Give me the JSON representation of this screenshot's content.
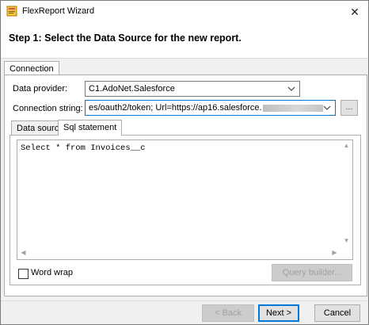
{
  "window": {
    "title": "FlexReport Wizard",
    "close_glyph": "✕"
  },
  "header": {
    "step_title": "Step 1: Select the Data Source for the new report."
  },
  "outer_tabs": [
    {
      "label": "Connection"
    }
  ],
  "connection": {
    "data_provider_label": "Data provider:",
    "data_provider_value": "C1.AdoNet.Salesforce",
    "connection_string_label": "Connection string:",
    "connection_string_value": "es/oauth2/token; Url=https://ap16.salesforce.",
    "browse_label": "..."
  },
  "inner_tabs": [
    {
      "label": "Data source"
    },
    {
      "label": "Sql statement"
    }
  ],
  "sql": {
    "text": "Select * from Invoices__c"
  },
  "word_wrap": {
    "label": "Word wrap",
    "checked": false
  },
  "query_builder_label": "Query builder...",
  "footer": {
    "back_label": "< Back",
    "next_label": "Next >",
    "cancel_label": "Cancel"
  },
  "icons": {
    "app": "report-icon",
    "close": "close-icon",
    "dropdown": "chevron-down-icon",
    "scroll_up": "scroll-up-arrow-icon",
    "scroll_down": "scroll-down-arrow-icon",
    "scroll_left": "scroll-left-arrow-icon",
    "scroll_right": "scroll-right-arrow-icon"
  },
  "colors": {
    "accent": "#0078d7",
    "window_bg": "#f0f0f0",
    "panel_bg": "#ffffff"
  }
}
